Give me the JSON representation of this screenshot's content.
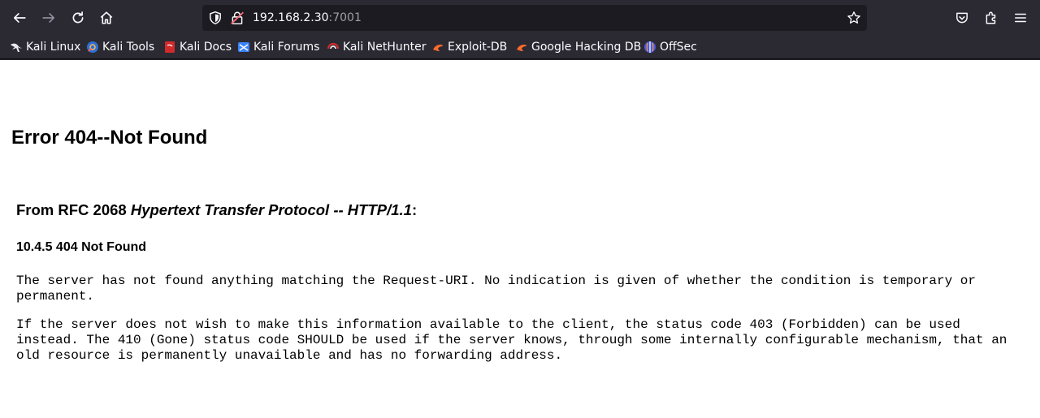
{
  "browser": {
    "url_host": "192.168.2.30",
    "url_port": ":7001"
  },
  "bookmarks": [
    {
      "label": "Kali Linux",
      "icon": "kali-dragon-icon"
    },
    {
      "label": "Kali Tools",
      "icon": "kali-tools-icon"
    },
    {
      "label": "Kali Docs",
      "icon": "kali-docs-icon"
    },
    {
      "label": "Kali Forums",
      "icon": "kali-forums-icon"
    },
    {
      "label": "Kali NetHunter",
      "icon": "kali-nethunter-icon"
    },
    {
      "label": "Exploit-DB",
      "icon": "exploit-db-icon"
    },
    {
      "label": "Google Hacking DB",
      "icon": "google-hacking-db-icon"
    },
    {
      "label": "OffSec",
      "icon": "offsec-icon"
    }
  ],
  "page": {
    "error_title": "Error 404--Not Found",
    "rfc_prefix": "From RFC 2068 ",
    "rfc_italic": "Hypertext Transfer Protocol -- HTTP/1.1",
    "rfc_suffix": ":",
    "section_title": "10.4.5 404 Not Found",
    "paragraph_1": "The server has not found anything matching the Request-URI. No indication is given of whether the condition is temporary or permanent.",
    "paragraph_2": "If the server does not wish to make this information available to the client, the status code 403 (Forbidden) can be used instead. The 410 (Gone) status code SHOULD be used if the server knows, through some internally configurable mechanism, that an old resource is permanently unavailable and has no forwarding address."
  },
  "colors": {
    "chrome_bg": "#2b2a33",
    "url_bg": "#1c1b22",
    "text_light": "#fbfbfe"
  }
}
